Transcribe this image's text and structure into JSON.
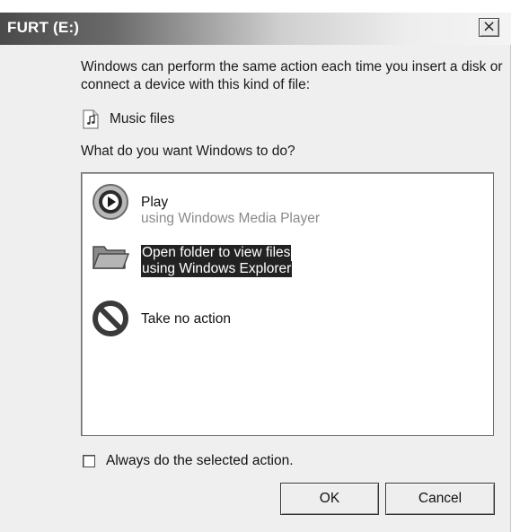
{
  "window": {
    "title": "FURT (E:)",
    "close_glyph": "×"
  },
  "intro": {
    "text": "Windows can perform the same action each time you insert a disk or connect a device with this kind of file:"
  },
  "file_type": {
    "label": "Music files",
    "icon": "music-file-icon"
  },
  "question": "What do you want Windows to do?",
  "actions": [
    {
      "title": "Play",
      "subtitle": "using Windows Media Player",
      "icon": "play-icon",
      "selected": false
    },
    {
      "title": "Open folder to view files",
      "subtitle": "using Windows Explorer",
      "icon": "folder-icon",
      "selected": true
    },
    {
      "title": "Take no action",
      "subtitle": "",
      "icon": "no-action-icon",
      "selected": false
    }
  ],
  "always_checkbox": {
    "label": "Always do the selected action.",
    "checked": false
  },
  "buttons": {
    "ok": "OK",
    "cancel": "Cancel"
  }
}
